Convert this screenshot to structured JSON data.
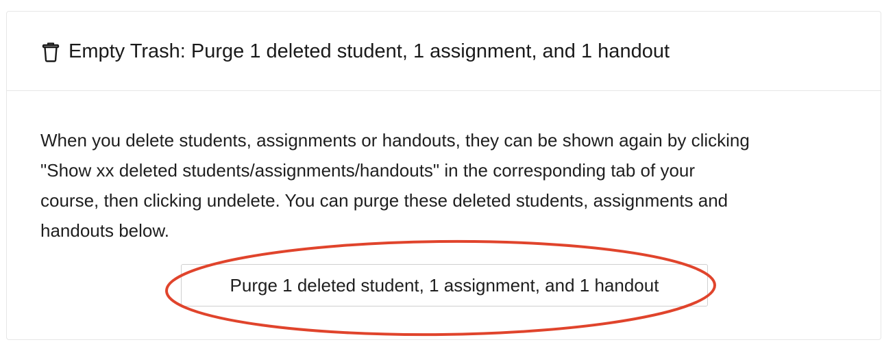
{
  "header": {
    "icon": "trash-icon",
    "title": "Empty Trash: Purge 1 deleted student, 1 assignment, and 1 handout"
  },
  "body": {
    "description_lines": [
      "When you delete students, assignments or handouts, they can be shown again by clicking",
      "\"Show xx deleted students/assignments/handouts\" in the corresponding tab of your",
      "course, then clicking undelete. You can purge these deleted students, assignments and",
      "handouts below."
    ],
    "purge_button_label": "Purge 1 deleted student, 1 assignment, and 1 handout"
  },
  "annotation": {
    "color": "#e0442c"
  }
}
